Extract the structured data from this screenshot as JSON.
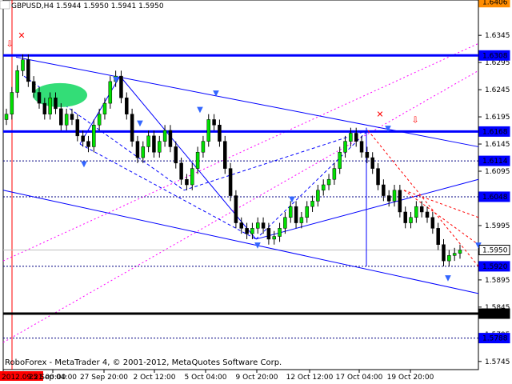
{
  "chart_data": {
    "type": "candlestick",
    "title": "GBPUSD,H4  1.5944 1.5950 1.5941 1.5950",
    "symbol": "GBPUSD",
    "timeframe": "H4",
    "ohlc_current": {
      "open": 1.5944,
      "high": 1.595,
      "low": 1.5941,
      "close": 1.595
    },
    "footer": "RoboForex - MetaTrader 4, © 2001-2012, MetaQuotes Software Corp.",
    "ylim": [
      1.573,
      1.641
    ],
    "y_ticks": [
      "1.6345",
      "1.6295",
      "1.6245",
      "1.6195",
      "1.6145",
      "1.6095",
      "1.6045",
      "1.5995",
      "1.5945",
      "1.5895",
      "1.5845",
      "1.5795",
      "1.5745"
    ],
    "x_labels": [
      "2012.09.21 00:00",
      "25 Sep 04:00",
      "27 Sep 20:00",
      "2 Oct 12:00",
      "5 Oct 04:00",
      "9 Oct 20:00",
      "12 Oct 12:00",
      "17 Oct 04:00",
      "19 Oct 20:00"
    ],
    "level_labels": [
      {
        "text": "1.6406",
        "value": 1.6406,
        "style": "top"
      },
      {
        "text": "1.6308",
        "value": 1.6308,
        "style": "thick"
      },
      {
        "text": "1.6168",
        "value": 1.6168,
        "style": "thick"
      },
      {
        "text": "1.6114",
        "value": 1.6114,
        "style": "dotted"
      },
      {
        "text": "1.6048",
        "value": 1.6048,
        "style": "dotted"
      },
      {
        "text": "1.5950",
        "value": 1.595,
        "style": "current"
      },
      {
        "text": "1.5920",
        "value": 1.592,
        "style": "dotted"
      },
      {
        "text": "1.5833",
        "value": 1.5833,
        "style": "thick-black"
      },
      {
        "text": "1.5788",
        "value": 1.5788,
        "style": "dotted"
      }
    ],
    "series": [
      {
        "name": "GBPUSD H4",
        "closes": [
          1.62,
          1.624,
          1.628,
          1.63,
          1.626,
          1.624,
          1.622,
          1.62,
          1.623,
          1.621,
          1.618,
          1.62,
          1.619,
          1.616,
          1.615,
          1.614,
          1.618,
          1.62,
          1.622,
          1.626,
          1.627,
          1.623,
          1.62,
          1.615,
          1.612,
          1.614,
          1.616,
          1.613,
          1.615,
          1.617,
          1.614,
          1.611,
          1.608,
          1.607,
          1.61,
          1.613,
          1.615,
          1.619,
          1.618,
          1.615,
          1.61,
          1.605,
          1.6,
          1.599,
          1.598,
          1.599,
          1.6,
          1.599,
          1.597,
          1.5975,
          1.599,
          1.601,
          1.603,
          1.6,
          1.601,
          1.603,
          1.604,
          1.606,
          1.607,
          1.608,
          1.61,
          1.613,
          1.615,
          1.6165,
          1.615,
          1.613,
          1.612,
          1.61,
          1.607,
          1.605,
          1.604,
          1.606,
          1.602,
          1.6,
          1.601,
          1.603,
          1.602,
          1.601,
          1.599,
          1.596,
          1.593,
          1.594,
          1.5944,
          1.595
        ]
      }
    ],
    "grid": false,
    "colors": {
      "bull": "#00e000",
      "bear": "#000000",
      "level_line": "#0000ff",
      "trend_line": "#0000ff",
      "fib_line": "#ff00ff",
      "arrow_red": "#ff0000"
    }
  }
}
